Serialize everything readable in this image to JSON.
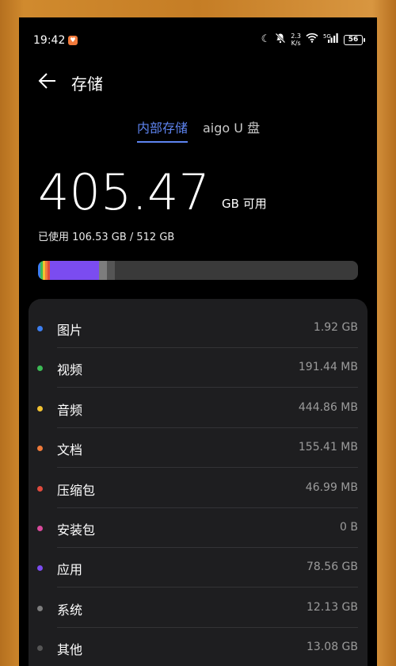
{
  "status_bar": {
    "time": "19:42",
    "net_speed_value": "2.3",
    "net_speed_unit": "K/s",
    "signal_label": "5G",
    "battery": "56"
  },
  "header": {
    "title": "存储",
    "back_icon": "arrow-left-icon"
  },
  "tabs": [
    {
      "label": "内部存储",
      "active": true
    },
    {
      "label": "aigo U 盘",
      "active": false
    }
  ],
  "summary": {
    "free_value": "405.47",
    "free_unit": "GB 可用",
    "used_text": "已使用 106.53 GB / 512 GB"
  },
  "storage_bar": {
    "segments": [
      {
        "name": "图片",
        "color": "#3c7ef0",
        "fraction": 0.0037
      },
      {
        "name": "视频",
        "color": "#3cba55",
        "fraction": 0.0004
      },
      {
        "name": "音频",
        "color": "#f2c231",
        "fraction": 0.0009
      },
      {
        "name": "文档",
        "color": "#ef7a3a",
        "fraction": 0.0003
      },
      {
        "name": "压缩包",
        "color": "#e04a3d",
        "fraction": 0.0001
      },
      {
        "name": "安装包",
        "color": "#d94a9c",
        "fraction": 0.0
      },
      {
        "name": "应用",
        "color": "#7b4cf0",
        "fraction": 0.1534
      },
      {
        "name": "系统",
        "color": "#7d7d7d",
        "fraction": 0.0237
      },
      {
        "name": "其他",
        "color": "#555555",
        "fraction": 0.0255
      }
    ],
    "track_color": "#3a3a3a"
  },
  "categories": [
    {
      "label": "图片",
      "value": "1.92 GB",
      "color": "#3c7ef0"
    },
    {
      "label": "视频",
      "value": "191.44 MB",
      "color": "#3cba55"
    },
    {
      "label": "音频",
      "value": "444.86 MB",
      "color": "#f2c231"
    },
    {
      "label": "文档",
      "value": "155.41 MB",
      "color": "#ef7a3a"
    },
    {
      "label": "压缩包",
      "value": "46.99 MB",
      "color": "#e04a3d"
    },
    {
      "label": "安装包",
      "value": "0 B",
      "color": "#d94a9c"
    },
    {
      "label": "应用",
      "value": "78.56 GB",
      "color": "#7b4cf0"
    },
    {
      "label": "系统",
      "value": "12.13 GB",
      "color": "#7d7d7d"
    },
    {
      "label": "其他",
      "value": "13.08 GB",
      "color": "#555555"
    }
  ]
}
